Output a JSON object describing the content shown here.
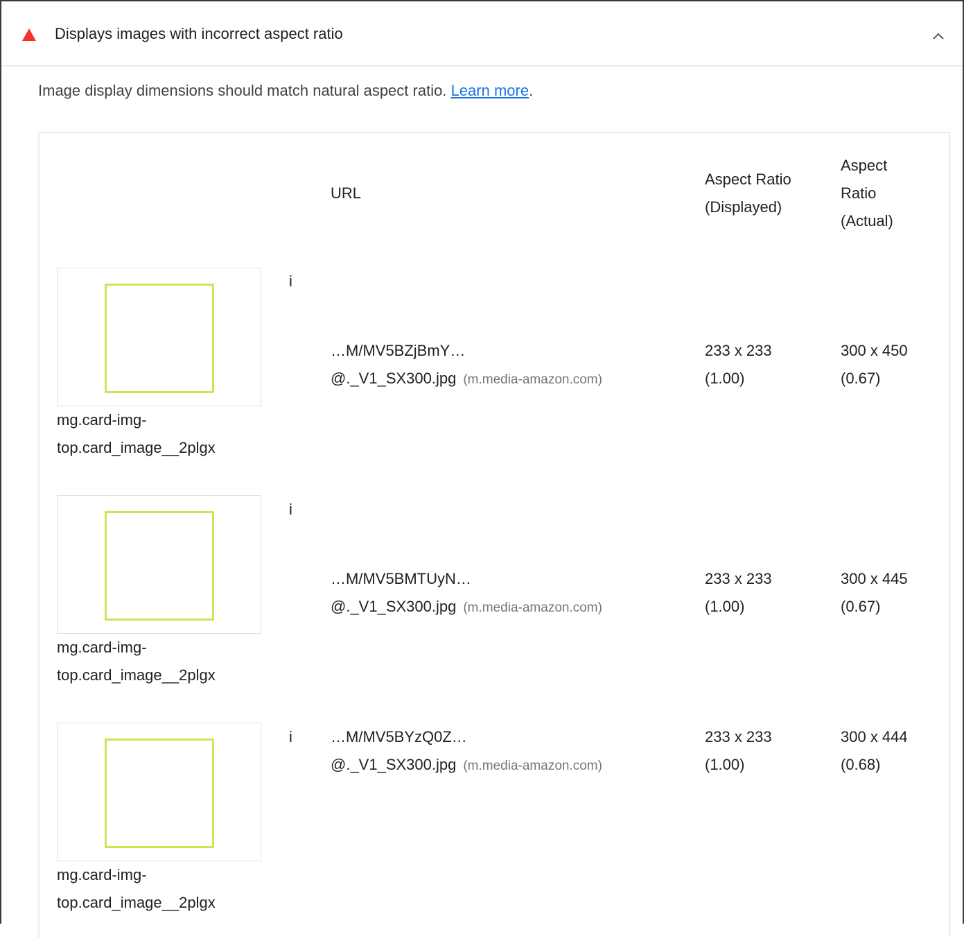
{
  "audit": {
    "title": "Displays images with incorrect aspect ratio",
    "status_color": "#f4342a",
    "expanded": true,
    "description": "Image display dimensions should match natural aspect ratio.",
    "learn_more": "Learn more",
    "description_tail": "."
  },
  "table": {
    "headers": {
      "url": "URL",
      "displayed": "Aspect Ratio (Displayed)",
      "actual": "Aspect Ratio (Actual)"
    },
    "rows": [
      {
        "node_prefix": "i",
        "node_label": "mg.card-img-top.card_image__2plgx",
        "url_line1": "…M/MV5BZjBmY…",
        "url_line2": "@._V1_SX300.jpg",
        "host": "(m.media-amazon.com)",
        "displayed_dims": "233 x 233",
        "displayed_ratio": "(1.00)",
        "actual_dims": "300 x 450",
        "actual_ratio": "(0.67)"
      },
      {
        "node_prefix": "i",
        "node_label": "mg.card-img-top.card_image__2plgx",
        "url_line1": "…M/MV5BMTUyN…",
        "url_line2": "@._V1_SX300.jpg",
        "host": "(m.media-amazon.com)",
        "displayed_dims": "233 x 233",
        "displayed_ratio": "(1.00)",
        "actual_dims": "300 x 445",
        "actual_ratio": "(0.67)"
      },
      {
        "node_prefix": "i",
        "node_label": "mg.card-img-top.card_image__2plgx",
        "url_line1": "…M/MV5BYzQ0Z…",
        "url_line2": "@._V1_SX300.jpg",
        "host": "(m.media-amazon.com)",
        "displayed_dims": "233 x 233",
        "displayed_ratio": "(1.00)",
        "actual_dims": "300 x 444",
        "actual_ratio": "(0.68)"
      }
    ]
  }
}
